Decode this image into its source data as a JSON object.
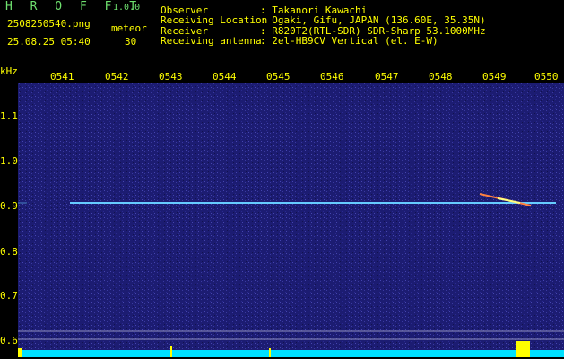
{
  "app": {
    "title": "H R O F F T",
    "version": "1.0.0"
  },
  "file": {
    "name": "2508250540.png",
    "datetime": "25.08.25 05:40"
  },
  "meteor": {
    "label": "meteor",
    "count": "30"
  },
  "info": [
    {
      "key": "Observer",
      "value": ": Takanori Kawachi"
    },
    {
      "key": "Receiving Location",
      "value": ": Ogaki, Gifu, JAPAN (136.60E, 35.35N)"
    },
    {
      "key": "Receiver",
      "value": ": R820T2(RTL-SDR) SDR-Sharp 53.1000MHz"
    },
    {
      "key": "Receiving antenna",
      "value": ": 2el-HB9CV Vertical (el. E-W)"
    }
  ],
  "axis": {
    "y_unit": "kHz",
    "time_labels": [
      "0541",
      "0542",
      "0543",
      "0544",
      "0545",
      "0546",
      "0547",
      "0548",
      "0549",
      "0550"
    ],
    "freq_labels": [
      "1.1",
      "1.0",
      "0.9",
      "0.8",
      "0.7",
      "0.6"
    ]
  },
  "colors": {
    "background": "#000000",
    "plot_bg": "#1a1a6e",
    "label": "#ffff00",
    "header_green": "#6ee06e",
    "carrier": "#66ccff",
    "meteor": "#ff8040"
  }
}
